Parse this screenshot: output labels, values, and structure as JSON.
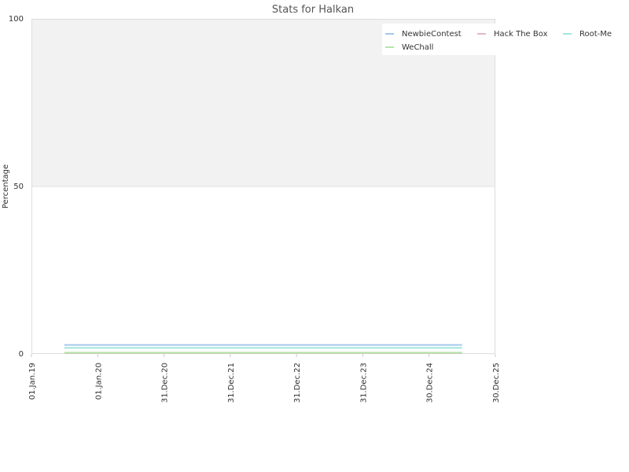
{
  "chart_data": {
    "type": "line",
    "title": "Stats for Halkan",
    "ylabel": "Percentage",
    "xlabel": "",
    "ylim": [
      0,
      100
    ],
    "yticks": [
      "0",
      "50",
      "100"
    ],
    "xlim": [
      "2019-01-01",
      "2025-12-30"
    ],
    "xticks": [
      {
        "date": "2019-01-01",
        "label": "01.Jan.19"
      },
      {
        "date": "2020-01-01",
        "label": "01.Jan.20"
      },
      {
        "date": "2020-12-31",
        "label": "31.Dec.20"
      },
      {
        "date": "2021-12-31",
        "label": "31.Dec.21"
      },
      {
        "date": "2022-12-31",
        "label": "31.Dec.22"
      },
      {
        "date": "2023-12-31",
        "label": "31.Dec.23"
      },
      {
        "date": "2024-12-30",
        "label": "30.Dec.24"
      },
      {
        "date": "2025-12-30",
        "label": "30.Dec.25"
      }
    ],
    "upper_band": [
      50,
      100
    ],
    "legend_position": "top-right",
    "series": [
      {
        "name": "NewbieContest",
        "color": "#a3c8ec",
        "x": [
          "2019-07-01",
          "2025-06-30"
        ],
        "y": [
          2.7,
          2.7
        ]
      },
      {
        "name": "Hack The Box",
        "color": "#e8b4cf",
        "x": [
          "2019-07-01",
          "2025-06-30"
        ],
        "y": [
          0.3,
          0.3
        ]
      },
      {
        "name": "Root-Me",
        "color": "#a4e6e0",
        "x": [
          "2019-07-01",
          "2025-06-30"
        ],
        "y": [
          1.8,
          1.8
        ]
      },
      {
        "name": "WeChall",
        "color": "#b4e6a8",
        "x": [
          "2019-07-01",
          "2025-06-30"
        ],
        "y": [
          0.4,
          0.4
        ]
      }
    ]
  }
}
